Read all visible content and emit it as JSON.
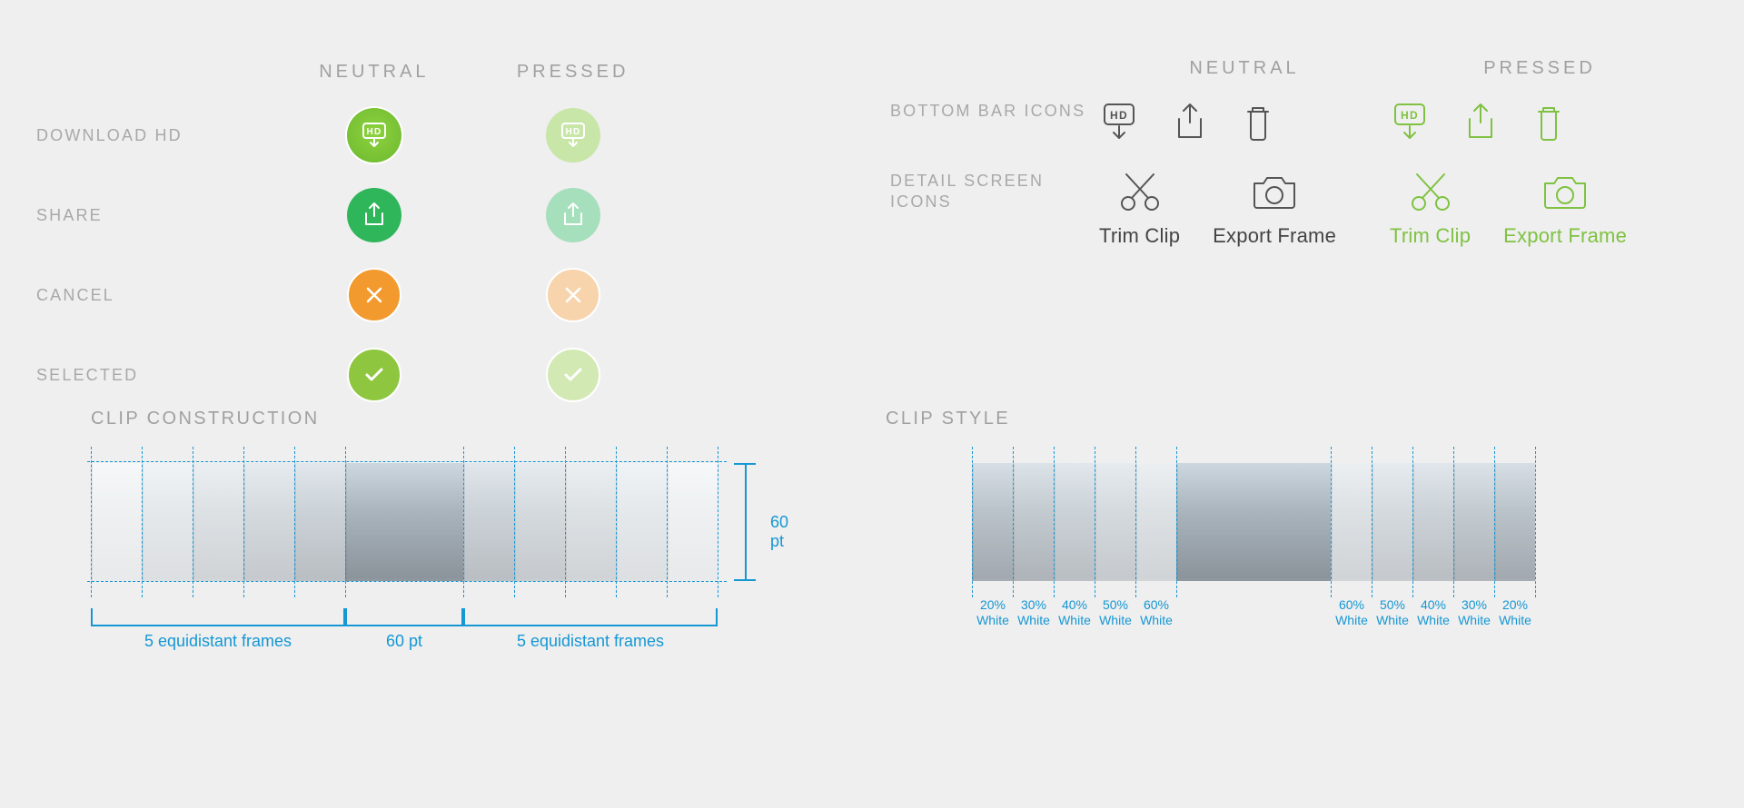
{
  "columns": {
    "neutral": "NEUTRAL",
    "pressed": "PRESSED"
  },
  "left_rows": {
    "download_hd": "DOWNLOAD HD",
    "share": "SHARE",
    "cancel": "CANCEL",
    "selected": "SELECTED"
  },
  "right_rows": {
    "bottom_bar": "BOTTOM BAR ICONS",
    "detail_screen": "DETAIL SCREEN ICONS"
  },
  "detail_labels": {
    "trim_clip": "Trim Clip",
    "export_frame": "Export Frame"
  },
  "clip_construction": {
    "title": "CLIP CONSTRUCTION",
    "height_label": "60 pt",
    "center_label": "60 pt",
    "side_label": "5 equidistant frames"
  },
  "clip_style": {
    "title": "CLIP STYLE",
    "overlays_left": [
      "20% White",
      "30% White",
      "40% White",
      "50% White",
      "60% White"
    ],
    "overlays_right": [
      "60% White",
      "50% White",
      "40% White",
      "30% White",
      "20% White"
    ]
  },
  "colors": {
    "annotation_blue": "#1597d4",
    "green_accent": "#7fc241",
    "share_green": "#2fb65a",
    "cancel_orange": "#f29a2e"
  }
}
